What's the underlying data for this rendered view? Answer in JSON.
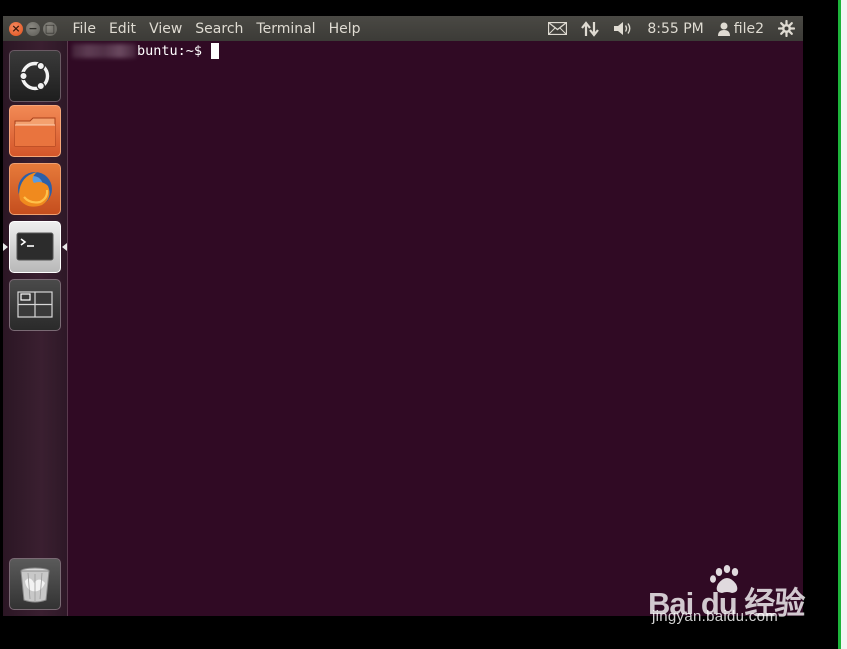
{
  "menus": [
    "File",
    "Edit",
    "View",
    "Search",
    "Terminal",
    "Help"
  ],
  "window_buttons": {
    "close": "×",
    "minimize": "−",
    "maximize": "□"
  },
  "indicators": {
    "time": "8:55 PM",
    "user": "file2"
  },
  "launcher": {
    "items": [
      "dash-home",
      "files",
      "firefox",
      "terminal",
      "workspace-switcher",
      "trash"
    ],
    "active": "terminal"
  },
  "terminal": {
    "prompt_visible": "buntu:~$"
  },
  "watermark": {
    "brand": "Bai du 经验",
    "url": "jingyan.baidu.com"
  },
  "colors": {
    "terminal_bg": "#300a24",
    "panel_bg": "#3c3b37",
    "accent_orange": "#e0501a",
    "right_edge_green": "#1db33a"
  }
}
